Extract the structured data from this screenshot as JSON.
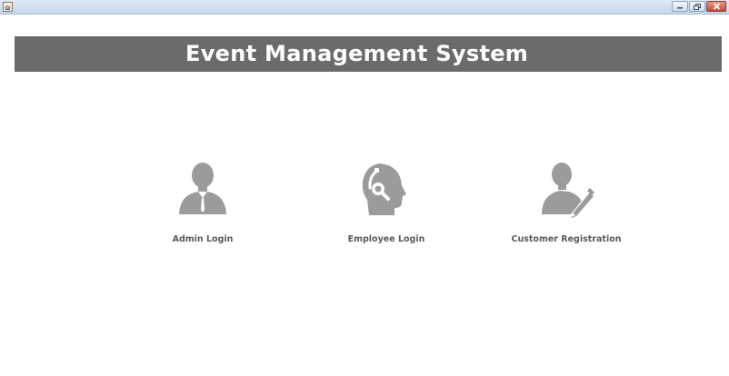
{
  "window": {
    "title": "",
    "controls": [
      {
        "name": "minimize",
        "icon": "minimize-icon"
      },
      {
        "name": "maximize",
        "icon": "maximize-icon"
      },
      {
        "name": "close",
        "icon": "close-icon"
      }
    ]
  },
  "header": {
    "title": "Event Management System",
    "background": "#6b6b6b",
    "text_color": "#ffffff"
  },
  "options": [
    {
      "label": "Admin Login",
      "icon": "admin-user-icon"
    },
    {
      "label": "Employee Login",
      "icon": "headset-support-icon"
    },
    {
      "label": "Customer Registration",
      "icon": "user-edit-icon"
    }
  ],
  "colors": {
    "icon": "#9b9b9b",
    "label": "#5a5a5a"
  }
}
